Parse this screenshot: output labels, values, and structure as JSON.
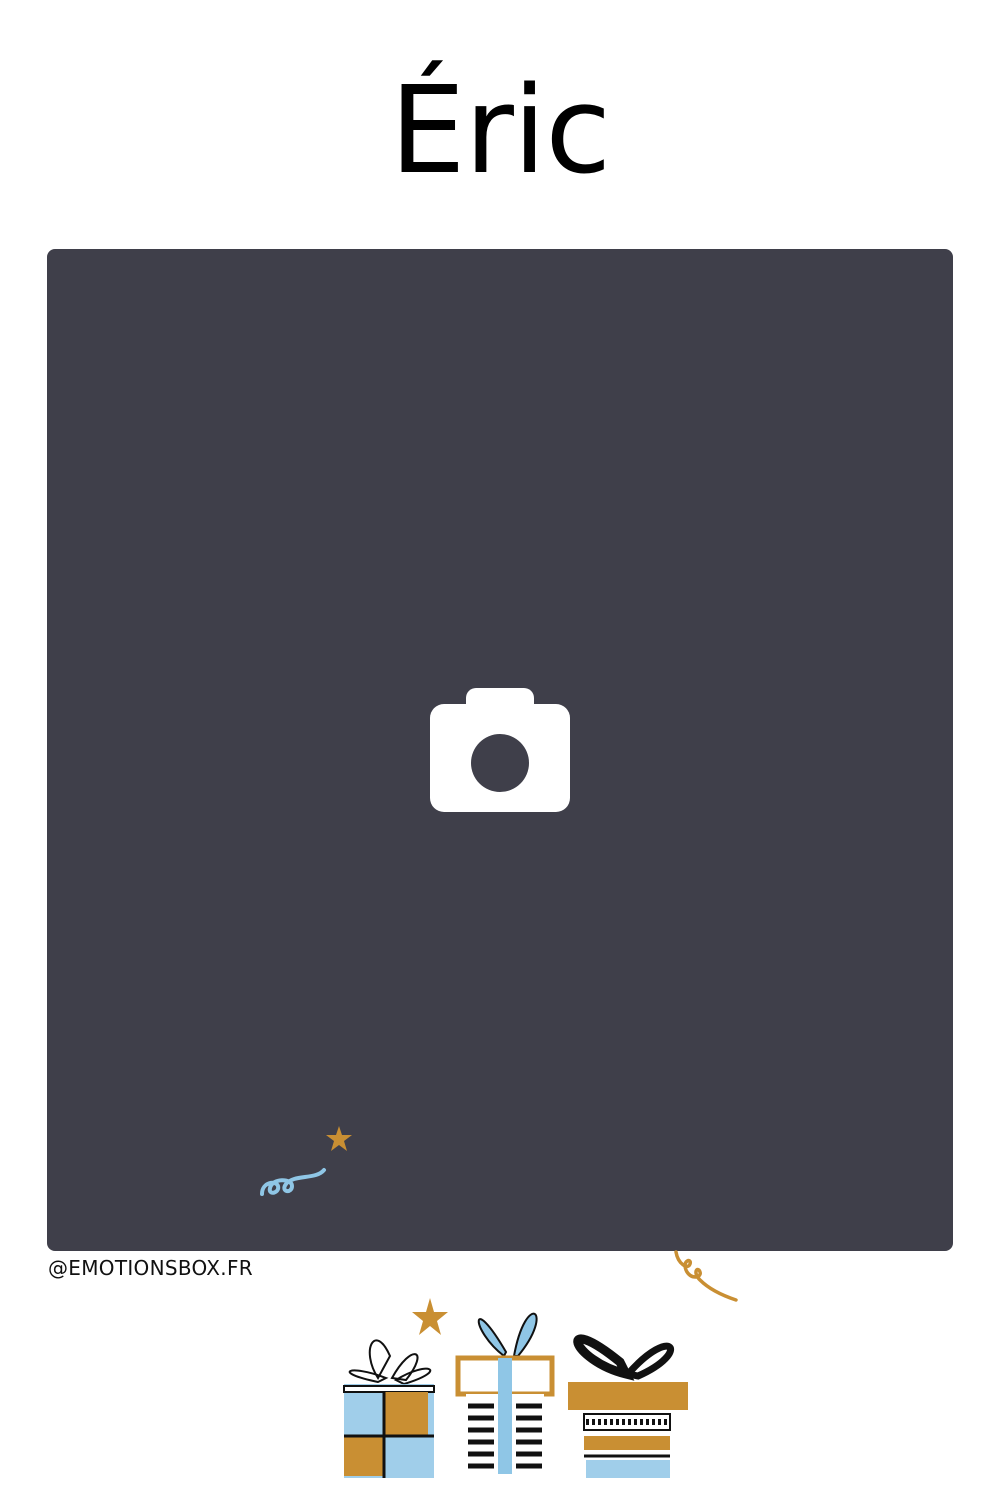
{
  "card": {
    "name": "Éric",
    "photo_placeholder_icon": "camera-icon",
    "handle": "@EMOTIONSBOX.FR"
  },
  "colors": {
    "background": "#ffffff",
    "photo_frame": "#3f3f4a",
    "camera": "#ffffff",
    "gold": "#c98f33",
    "blue": "#8fc6e6",
    "ink": "#111111"
  },
  "decorations": {
    "icons": [
      "star-icon",
      "ribbon-icon",
      "gift-box-icon"
    ]
  }
}
